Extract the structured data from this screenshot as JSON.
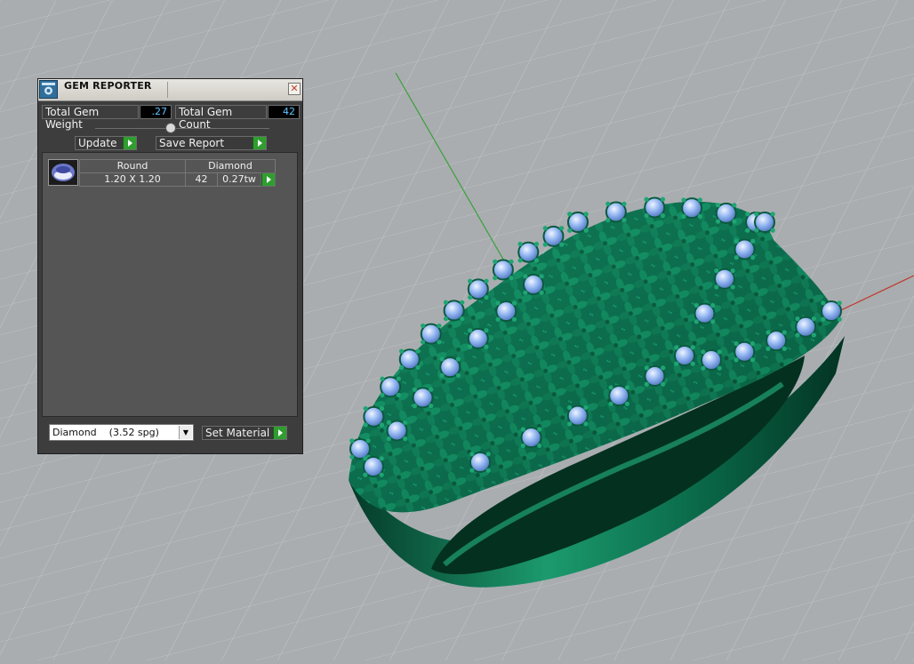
{
  "panel": {
    "title": "GEM REPORTER",
    "close_glyph": "✕",
    "total_gem_weight_label": "Total Gem Weight",
    "total_gem_weight_value": ".27",
    "total_gem_count_label": "Total Gem Count",
    "total_gem_count_value": "42",
    "update_label": "Update",
    "save_report_label": "Save Report",
    "table": {
      "shape": "Round",
      "material": "Diamond",
      "size": "1.20 X 1.20",
      "count": "42",
      "weight": "0.27tw"
    },
    "material_select_value": "Diamond    (3.52 spg)",
    "set_material_label": "Set Material"
  },
  "icons": {
    "app": "gem-reporter-icon",
    "close": "close-icon",
    "play": "play-arrow-icon",
    "dropdown": "chevron-down-icon",
    "gem": "round-gem-icon"
  },
  "colors": {
    "viewport_bg": "#a9adb0",
    "ring_metal": "#0f7a58",
    "gem_blue": "#7fa8e8",
    "axis_green": "#3aa03a",
    "axis_red": "#c0392b",
    "value_text": "#5fc3ff",
    "panel_bg": "#3d3d3d"
  }
}
